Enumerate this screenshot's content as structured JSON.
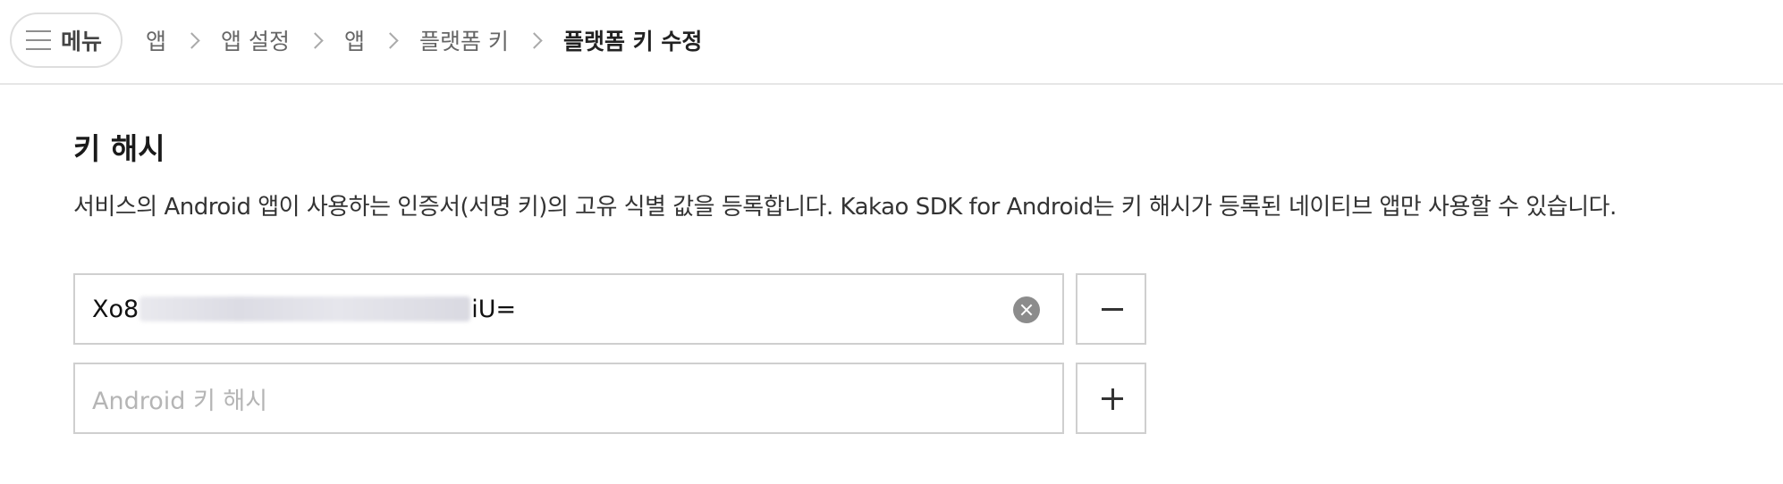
{
  "header": {
    "menu_label": "메뉴",
    "breadcrumb": [
      {
        "label": "앱"
      },
      {
        "label": "앱 설정"
      },
      {
        "label": "앱"
      },
      {
        "label": "플랫폼 키"
      },
      {
        "label": "플랫폼 키 수정"
      }
    ]
  },
  "section": {
    "title": "키 해시",
    "description": "서비스의 Android 앱이 사용하는 인증서(서명 키)의 고유 식별 값을 등록합니다. Kakao SDK for Android는 키 해시가 등록된 네이티브 앱만 사용할 수 있습니다."
  },
  "key_hashes": {
    "entries": [
      {
        "value_prefix": "Xo8",
        "value_suffix": "iU="
      }
    ],
    "new_entry_placeholder": "Android 키 해시"
  },
  "icons": {
    "menu": "hamburger-icon",
    "breadcrumb_separator": "chevron-right-icon",
    "clear": "clear-icon",
    "remove": "minus-icon",
    "add": "plus-icon"
  },
  "colors": {
    "text": "#222222",
    "muted": "#666666",
    "border": "#cfcfcf",
    "placeholder": "#b5b5b5",
    "clear_icon": "#8c8c8c"
  }
}
